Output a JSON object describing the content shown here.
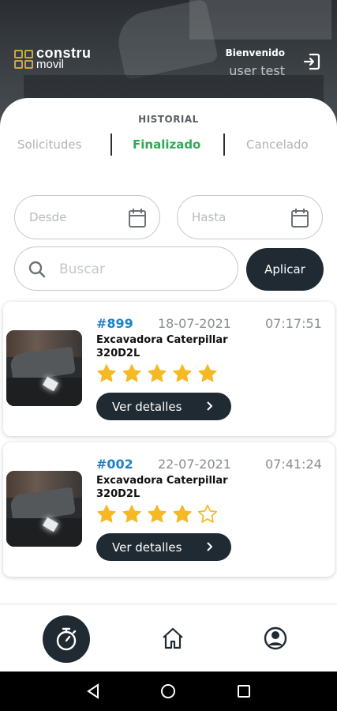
{
  "header": {
    "brand_line1": "constru",
    "brand_line2": "movil",
    "welcome_label": "Bienvenido",
    "username": "user test"
  },
  "history": {
    "title": "HISTORIAL",
    "tabs": [
      {
        "label": "Solicitudes",
        "active": false
      },
      {
        "label": "Finalizado",
        "active": true
      },
      {
        "label": "Cancelado",
        "active": false
      }
    ]
  },
  "filters": {
    "from_placeholder": "Desde",
    "to_placeholder": "Hasta",
    "search_placeholder": "Buscar",
    "apply_label": "Aplicar"
  },
  "orders": [
    {
      "id": "#899",
      "date": "18-07-2021",
      "time": "07:17:51",
      "name": "Excavadora Caterpillar 320D2L",
      "rating": 5,
      "max_rating": 5,
      "button_label": "Ver detalles"
    },
    {
      "id": "#002",
      "date": "22-07-2021",
      "time": "07:41:24",
      "name": "Excavadora Caterpillar 320D2L",
      "rating": 4,
      "max_rating": 5,
      "button_label": "Ver detalles"
    }
  ],
  "nav": {
    "items": [
      "timer-icon",
      "home-icon",
      "profile-icon"
    ],
    "active": "timer-icon"
  },
  "colors": {
    "accent_green": "#2eaa55",
    "dark": "#1f2a33",
    "order_id_blue": "#1f82c6",
    "star_yellow": "#f5b923",
    "logo_gold": "#c9a84a"
  }
}
